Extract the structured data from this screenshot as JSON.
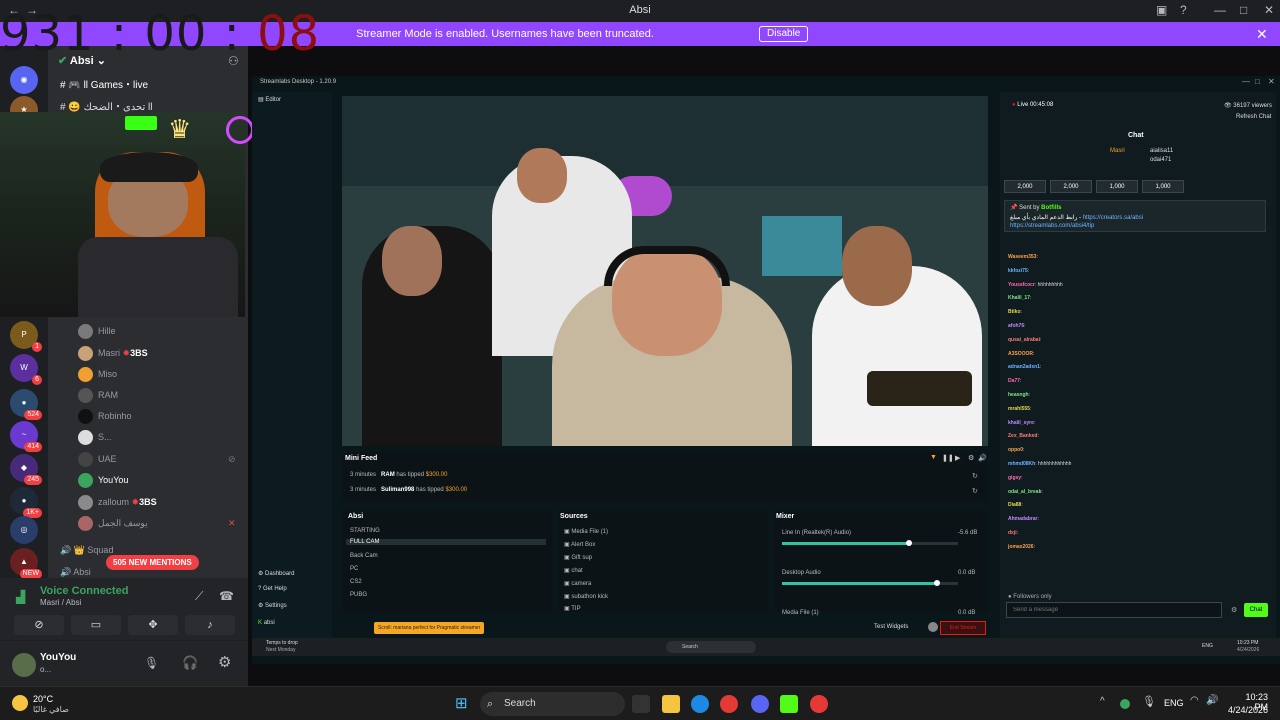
{
  "titlebar": {
    "title": "Absi"
  },
  "timer": {
    "h": "931",
    "m": "00",
    "s": "08",
    "sep": ":"
  },
  "banner": {
    "message": "Streamer Mode is enabled. Usernames have been truncated.",
    "button": "Disable"
  },
  "discord": {
    "server_name": "Absi",
    "channels": [
      {
        "label": "ll Games・live"
      },
      {
        "label": "تحدي・الضحك ll"
      }
    ],
    "server_badges": [
      "1",
      "6",
      "524",
      "414",
      "245",
      "1K+",
      "NEW"
    ],
    "members": [
      {
        "name": "Hille"
      },
      {
        "name": "Masri",
        "tag": "3BS"
      },
      {
        "name": "Miso"
      },
      {
        "name": "RAM"
      },
      {
        "name": "Robinho"
      },
      {
        "name": "S..."
      },
      {
        "name": "UAE"
      },
      {
        "name": "YouYou"
      },
      {
        "name": "zalloum",
        "tag": "3BS"
      },
      {
        "name": "يوسف الجمل"
      }
    ],
    "squad_label": "Squad",
    "absi_label": "Absi",
    "mentions": "505 NEW MENTIONS",
    "voice": {
      "status": "Voice Connected",
      "channel": "Masri / Absi"
    },
    "user": {
      "name": "YouYou",
      "status": "o..."
    }
  },
  "streamlabs": {
    "title": "Streamlabs Desktop - 1.20.9",
    "nav": [
      "Editor",
      "Dashboard",
      "Get Help",
      "Settings",
      "absi"
    ],
    "live": "Live 00:45:08",
    "viewers": "36197 viewers",
    "refresh": "Refresh Chat",
    "chat_title": "Chat",
    "top_gifters": [
      "Masri",
      "aialisa11",
      "odai471"
    ],
    "gift_values": [
      "2,000",
      "2,000",
      "1,000",
      "1,000"
    ],
    "pinned_by": "Sent by",
    "pinned_user": "Botfills",
    "pinned_text": "رابط الدعم المادي بأي مبلغ",
    "pinned_link1": "https://creators.sa/absi",
    "pinned_link2": "https://streamlabs.com/absi4/tip",
    "chat": [
      {
        "user": "Waseem353",
        "msg": ""
      },
      {
        "user": "kkfozi75",
        "msg": ""
      },
      {
        "user": "Youssfcocr",
        "msg": "hhhhhhhhh"
      },
      {
        "user": "Khalil_17",
        "msg": ""
      },
      {
        "user": "Btiko",
        "msg": ""
      },
      {
        "user": "afoh76",
        "msg": ""
      },
      {
        "user": "qusai_alrabai",
        "msg": ""
      },
      {
        "user": "A3SOOOR",
        "msg": ""
      },
      {
        "user": "adnan2adsn1",
        "msg": ""
      },
      {
        "user": "Da77",
        "msg": ""
      },
      {
        "user": "heasngh",
        "msg": ""
      },
      {
        "user": "mrahl555",
        "msg": ""
      },
      {
        "user": "khalil_syre",
        "msg": ""
      },
      {
        "user": "Zex_Banked",
        "msg": ""
      },
      {
        "user": "oppo0",
        "msg": ""
      },
      {
        "user": "mhmd08Kh",
        "msg": "hhhhhhhhhhhh"
      },
      {
        "user": "gigsy",
        "msg": ""
      },
      {
        "user": "odai_al_break",
        "msg": ""
      },
      {
        "user": "Dia88",
        "msg": ""
      },
      {
        "user": "Ahmadabrar",
        "msg": ""
      },
      {
        "user": "dxji",
        "msg": ""
      },
      {
        "user": "jomax2026",
        "msg": ""
      }
    ],
    "followers_only": "Followers only",
    "send_placeholder": "Send a message",
    "chat_button": "Chat",
    "mini_feed": {
      "title": "Mini Feed",
      "items": [
        {
          "time": "3 minutes",
          "user": "RAM",
          "action": "has tipped",
          "amount": "$300.00"
        },
        {
          "time": "3 minutes",
          "user": "Suliman998",
          "action": "has tipped",
          "amount": "$300.00"
        }
      ]
    },
    "scenes": {
      "title": "Absi",
      "items": [
        "STARTING",
        "FULL CAM",
        "Back Cam",
        "PC",
        "CS2",
        "PUBG"
      ]
    },
    "sources": {
      "title": "Sources",
      "items": [
        "Media File (1)",
        "Alert Box",
        "Gift sup",
        "chat",
        "camera",
        "subathon kick",
        "TIP"
      ]
    },
    "mixer": {
      "title": "Mixer",
      "items": [
        {
          "name": "Line In (Realtek(R) Audio)",
          "db": "-5.6 dB",
          "level": 0.72
        },
        {
          "name": "Desktop Audio",
          "db": "0.0 dB",
          "level": 0.88
        },
        {
          "name": "Media File (1)",
          "db": "0.0 dB",
          "level": 0.0
        }
      ]
    },
    "tip_banner": "Scroll: mariana perfect for Pragmatic streamer",
    "test_widgets": "Test Widgets",
    "end_stream": "End Stream"
  },
  "inner_taskbar": {
    "search": "Search",
    "time": "10:23 PM",
    "date": "4/24/2026",
    "lang": "ENG",
    "weather": "Temps to drop",
    "weather2": "Next Monday"
  },
  "taskbar": {
    "weather_temp": "20°C",
    "weather_desc": "صافي غالبًا",
    "search": "Search",
    "lang": "ENG",
    "time": "10:23 PM",
    "date": "4/24/2026"
  }
}
